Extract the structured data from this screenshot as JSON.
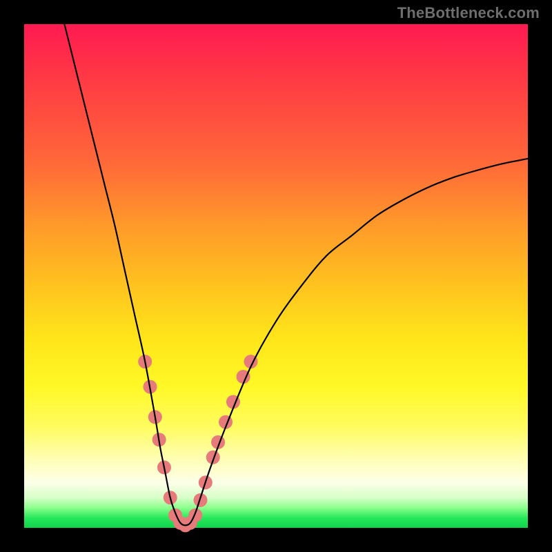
{
  "watermark": "TheBottleneck.com",
  "chart_data": {
    "type": "line",
    "title": "",
    "xlabel": "",
    "ylabel": "",
    "xlim": [
      0,
      100
    ],
    "ylim": [
      0,
      100
    ],
    "grid": false,
    "series": [
      {
        "name": "bottleneck-curve",
        "x": [
          8,
          10,
          12,
          14,
          16,
          18,
          20,
          22,
          24,
          26,
          27,
          28,
          29,
          30,
          31,
          32,
          33,
          34,
          35,
          37,
          40,
          45,
          50,
          55,
          60,
          65,
          70,
          75,
          80,
          85,
          90,
          95,
          100
        ],
        "values": [
          100,
          92,
          84,
          76,
          68,
          60,
          51,
          42,
          33,
          22,
          16,
          11,
          6,
          3,
          1,
          0.5,
          1,
          3,
          6,
          12,
          20,
          32,
          41,
          48,
          54,
          58,
          62,
          65,
          67.5,
          69.5,
          71,
          72.3,
          73.3
        ]
      }
    ],
    "markers": {
      "name": "salmon-dots",
      "color": "#e77a7a",
      "radius_px": 10,
      "points": [
        {
          "x": 24.0,
          "y": 33.0
        },
        {
          "x": 25.0,
          "y": 28.0
        },
        {
          "x": 26.0,
          "y": 22.0
        },
        {
          "x": 26.8,
          "y": 17.5
        },
        {
          "x": 27.8,
          "y": 12.0
        },
        {
          "x": 29.0,
          "y": 6.0
        },
        {
          "x": 30.0,
          "y": 2.5
        },
        {
          "x": 31.0,
          "y": 1.0
        },
        {
          "x": 32.0,
          "y": 0.5
        },
        {
          "x": 33.0,
          "y": 1.0
        },
        {
          "x": 34.0,
          "y": 2.5
        },
        {
          "x": 35.0,
          "y": 5.5
        },
        {
          "x": 36.0,
          "y": 9.0
        },
        {
          "x": 37.5,
          "y": 14.0
        },
        {
          "x": 38.5,
          "y": 17.0
        },
        {
          "x": 40.0,
          "y": 21.0
        },
        {
          "x": 41.5,
          "y": 25.0
        },
        {
          "x": 43.5,
          "y": 30.0
        },
        {
          "x": 45.0,
          "y": 33.0
        }
      ]
    }
  }
}
